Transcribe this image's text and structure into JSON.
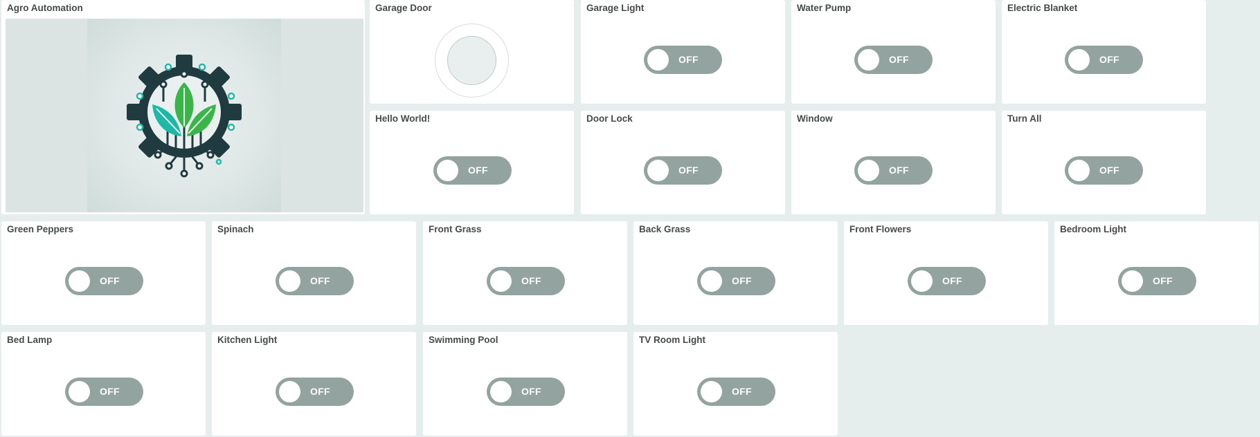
{
  "header_card": {
    "title": "Agro Automation",
    "logo": "agro-gear-leaf-circuit-logo"
  },
  "garage_door": {
    "title": "Garage Door"
  },
  "switches": {
    "garage_light": {
      "title": "Garage Light",
      "state": "OFF"
    },
    "water_pump": {
      "title": "Water Pump",
      "state": "OFF"
    },
    "electric_blanket": {
      "title": "Electric Blanket",
      "state": "OFF"
    },
    "hello_world": {
      "title": "Hello World!",
      "state": "OFF"
    },
    "door_lock": {
      "title": "Door Lock",
      "state": "OFF"
    },
    "window": {
      "title": "Window",
      "state": "OFF"
    },
    "turn_all": {
      "title": "Turn All",
      "state": "OFF"
    },
    "green_peppers": {
      "title": "Green Peppers",
      "state": "OFF"
    },
    "spinach": {
      "title": "Spinach",
      "state": "OFF"
    },
    "front_grass": {
      "title": "Front Grass",
      "state": "OFF"
    },
    "back_grass": {
      "title": "Back Grass",
      "state": "OFF"
    },
    "front_flowers": {
      "title": "Front Flowers",
      "state": "OFF"
    },
    "bedroom_light": {
      "title": "Bedroom Light",
      "state": "OFF"
    },
    "bed_lamp": {
      "title": "Bed Lamp",
      "state": "OFF"
    },
    "kitchen_light": {
      "title": "Kitchen Light",
      "state": "OFF"
    },
    "swimming_pool": {
      "title": "Swimming Pool",
      "state": "OFF"
    },
    "tv_room_light": {
      "title": "TV Room Light",
      "state": "OFF"
    }
  },
  "colors": {
    "background": "#e6eeed",
    "card": "#ffffff",
    "toggle_off": "#93a3a0",
    "title_text": "#444b4a",
    "logo_dark": "#1f3b40",
    "logo_green": "#3bb54a",
    "logo_teal": "#1fb8a6"
  }
}
